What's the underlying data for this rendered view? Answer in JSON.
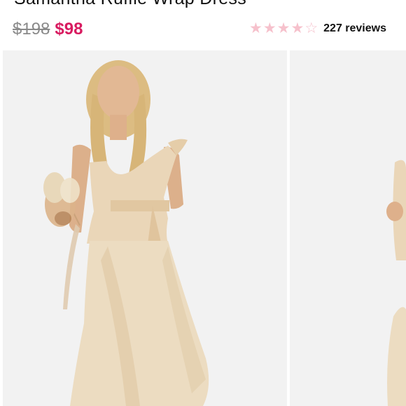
{
  "product": {
    "title": "Samantha Ruffle Wrap Dress",
    "original_price": "$198",
    "sale_price": "$98",
    "rating": 4,
    "rating_max": 5,
    "reviews_label": "227 reviews"
  },
  "colors": {
    "sale_price": "#d81b60",
    "star": "#f6c1cc",
    "photo_background": "#f1f1f1",
    "dress": "#e9d3b4"
  },
  "gallery": {
    "images": [
      "model-in-champagne-satin-wrap-dress",
      "model-in-champagne-satin-wrap-dress-partial"
    ]
  }
}
